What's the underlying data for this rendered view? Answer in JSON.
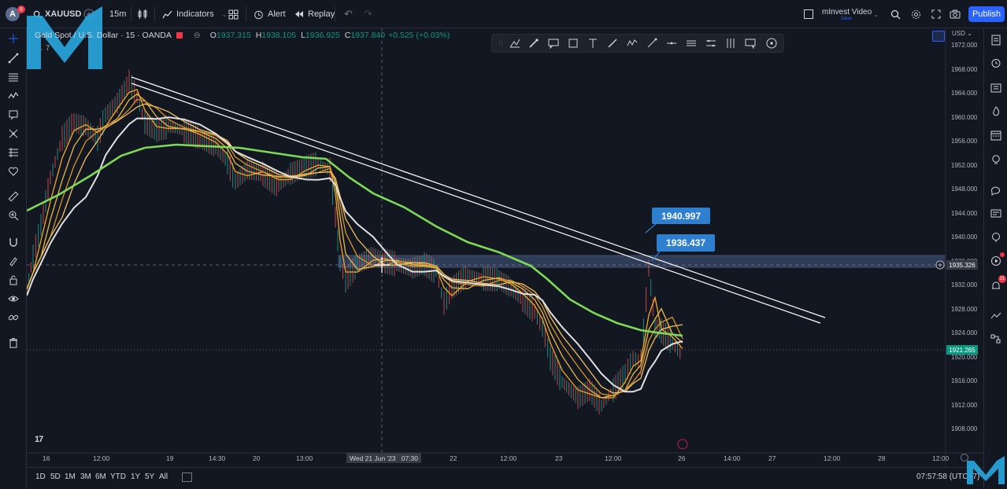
{
  "toolbar": {
    "avatar_letter": "A",
    "avatar_badge": "8",
    "symbol": "XAUUSD",
    "interval": "15m",
    "indicators_label": "Indicators",
    "alert_label": "Alert",
    "replay_label": "Replay",
    "layout_name": "mInvest Video",
    "save_status": "Save",
    "publish_label": "Publish"
  },
  "legend": {
    "title": "Gold Spot / U.S. Dollar · 15 · OANDA",
    "o_key": "O",
    "o": "1937.315",
    "h_key": "H",
    "h": "1938.105",
    "l_key": "L",
    "l": "1936.925",
    "c_key": "C",
    "c": "1937.840",
    "change": "+0.525 (+0.03%)",
    "indicator_count": "7"
  },
  "currency": "USD",
  "price_axis": [
    "1972.000",
    "1968.000",
    "1964.000",
    "1960.000",
    "1956.000",
    "1952.000",
    "1948.000",
    "1944.000",
    "1940.000",
    "1936.000",
    "1932.000",
    "1928.000",
    "1924.000",
    "1920.000",
    "1916.000",
    "1912.000",
    "1908.000"
  ],
  "price_values": [
    1972,
    1968,
    1964,
    1960,
    1956,
    1952,
    1948,
    1944,
    1940,
    1936,
    1932,
    1928,
    1924,
    1920,
    1916,
    1912,
    1908
  ],
  "crosshair_price": "1935.326",
  "last_price": "1921.265",
  "time_axis": [
    "16",
    "12:00",
    "19",
    "14:30",
    "20",
    "13:00",
    "22",
    "12:00",
    "23",
    "12:00",
    "26",
    "14:00",
    "27",
    "12:00",
    "28",
    "12:00"
  ],
  "crosshair_time": "Wed 21 Jun '23   07:30",
  "callouts": {
    "upper": "1940.997",
    "lower": "1936.437"
  },
  "ranges": [
    "1D",
    "5D",
    "1M",
    "3M",
    "6M",
    "YTD",
    "1Y",
    "5Y",
    "All"
  ],
  "clock": "07:57:58 (UTC+7)",
  "colors": {
    "background": "#131722",
    "accent": "#2962ff",
    "ema_green": "#7ed957",
    "ema_white": "#e0e0e0",
    "ema_gold": "#f5a623",
    "zone": "#3a4a6b",
    "callout": "#2f7fd0"
  },
  "icons": {
    "left": [
      "crosshair-icon",
      "trendline-icon",
      "fib-icon",
      "pattern-icon",
      "brush-icon",
      "text-icon",
      "measure-icon",
      "favorites-icon",
      "ruler-icon",
      "zoom-icon",
      "magnet-icon",
      "stay-in-drawing-icon",
      "lock-icon",
      "eye-icon",
      "link-icon",
      "trash-icon"
    ],
    "right": [
      "watchlist-icon",
      "alarm-icon",
      "data-window-icon",
      "hotlist-icon",
      "calendar-icon",
      "ideas-icon",
      "chat-icon",
      "news-icon",
      "streams-icon",
      "notifications-icon",
      "order-panel-icon",
      "dom-icon"
    ]
  }
}
